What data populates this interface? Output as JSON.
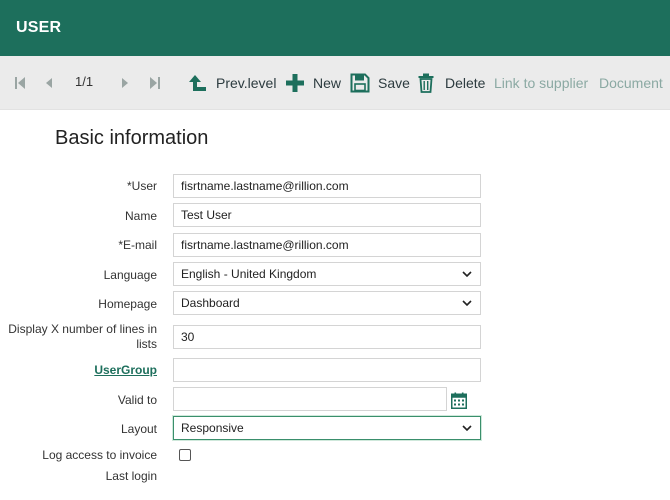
{
  "header": {
    "title": "USER"
  },
  "toolbar": {
    "pager": "1/1",
    "prev_level_label": "Prev.level",
    "new_label": "New",
    "save_label": "Save",
    "delete_label": "Delete",
    "link_supplier_label": "Link to supplier",
    "document_label": "Document"
  },
  "form": {
    "section_title": "Basic information",
    "user": {
      "label": "*User",
      "value": "fisrtname.lastname@rillion.com"
    },
    "name": {
      "label": "Name",
      "value": "Test User"
    },
    "email": {
      "label": "*E-mail",
      "value": "fisrtname.lastname@rillion.com"
    },
    "language": {
      "label": "Language",
      "value": "English - United Kingdom"
    },
    "homepage": {
      "label": "Homepage",
      "value": "Dashboard"
    },
    "lines": {
      "label": "Display X number of lines in lists",
      "value": "30"
    },
    "usergroup": {
      "label": "UserGroup",
      "value": ""
    },
    "valid_to": {
      "label": "Valid to",
      "value": ""
    },
    "layout": {
      "label": "Layout",
      "value": "Responsive"
    },
    "log_access": {
      "label": "Log access to invoice",
      "checked": false
    },
    "last_login": {
      "label": "Last login",
      "value": ""
    }
  },
  "colors": {
    "brand": "#1d6f5c",
    "toolbar_bg": "#ebebeb",
    "disabled_text": "#8ba9a3"
  }
}
